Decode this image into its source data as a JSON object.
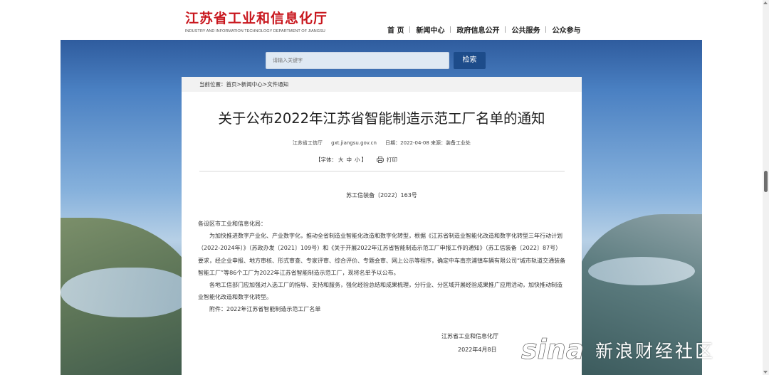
{
  "header": {
    "logo_cn": "江苏省工业和信息化厅",
    "logo_en": "INDUSTRY AND INFORMATION TECHNOLOGY DEPARTMENT OF JIANGSU",
    "nav": [
      "首 页",
      "新闻中心",
      "政府信息公开",
      "公共服务",
      "公众参与"
    ]
  },
  "search": {
    "placeholder": "请输入关键字",
    "button": "检索"
  },
  "breadcrumb": {
    "prefix": "当前位置：",
    "items": [
      "首页",
      "新闻中心",
      "文件通知"
    ],
    "sep": ">"
  },
  "article": {
    "title": "关于公布2022年江苏省智能制造示范工厂名单的通知",
    "meta": {
      "publisher": "江苏省工信厅",
      "site": "gxt.jiangsu.gov.cn",
      "date": "日期：2022-04-08 来源：装备工业处"
    },
    "tools": {
      "font_label_open": "【字体：",
      "large": "大",
      "medium": "中",
      "small": "小",
      "font_label_close": "】",
      "print": "打印"
    },
    "doc_number": "苏工信装备〔2022〕163号",
    "paragraphs": [
      "各设区市工业和信息化局：",
      "为加快推进数字产业化、产业数字化，推动全省制造业智能化改造和数字化转型，根据《江苏省制造业智能化改造和数字化转型三年行动计划（2022-2024年）》（苏政办发〔2021〕109号）和《关于开展2022年江苏省智能制造示范工厂申报工作的通知》（苏工信装备〔2022〕87号）要求，经企业申报、地方审核、形式审查、专家评审、综合评价、专题会审、网上公示等程序，确定中车南京浦镇车辆有限公司“城市轨道交通装备智能工厂”等86个工厂为2022年江苏省智能制造示范工厂，现将名单予以公布。",
      "各地工信部门应加强对入选工厂的指导、支持和服务，强化经验总结和成果梳理，分行业、分区域开展经验成果推广应用活动，加快推动制造业智能化改造和数字化转型。",
      "附件：2022年江苏省智能制造示范工厂名单"
    ],
    "signature": "江苏省工业和信息化厅",
    "sign_date": "2022年4月8日"
  },
  "watermark": {
    "logo": "sina",
    "text": "新浪财经社区"
  },
  "colors": {
    "logo_red": "#c8161d",
    "search_button": "#1d4c8a"
  }
}
